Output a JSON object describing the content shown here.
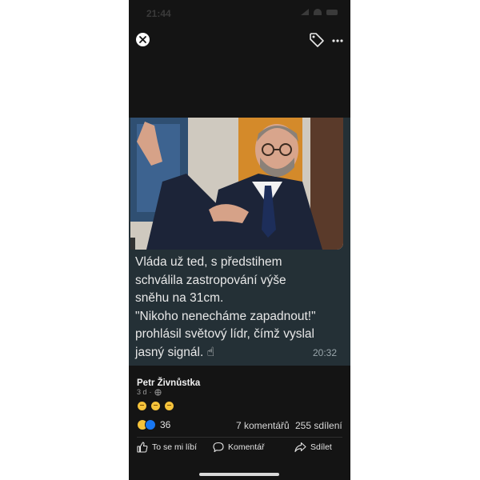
{
  "status_bar": {
    "time": "21:44"
  },
  "top_bar": {
    "close_icon": "close-icon",
    "tag_icon": "tag-icon",
    "more_icon": "more-icon"
  },
  "post": {
    "caption": "Vláda už ted, s předstihem\nschválila zastropování výše\nsněhu na 31cm.\n\"Nikoho nenecháme zapadnout!\"\nprohlásil světový lídr, čímž vyslal\njasný signál. ☝",
    "timestamp": "20:32",
    "author": "Petr Živnůstka",
    "age": "3 d",
    "age_separator": "·",
    "comment_emojis": [
      "grinning-emoji",
      "grinning-emoji",
      "grinning-emoji"
    ],
    "reaction_count": "36",
    "comments_count": "7 komentářů",
    "shares_count": "255 sdílení"
  },
  "actions": {
    "like": "To se mi líbí",
    "comment": "Komentář",
    "share": "Sdílet"
  },
  "colors": {
    "background": "#141414",
    "caption_bg": "#243036",
    "like_blue": "#1877f2",
    "haha_yellow": "#f5c33b"
  }
}
